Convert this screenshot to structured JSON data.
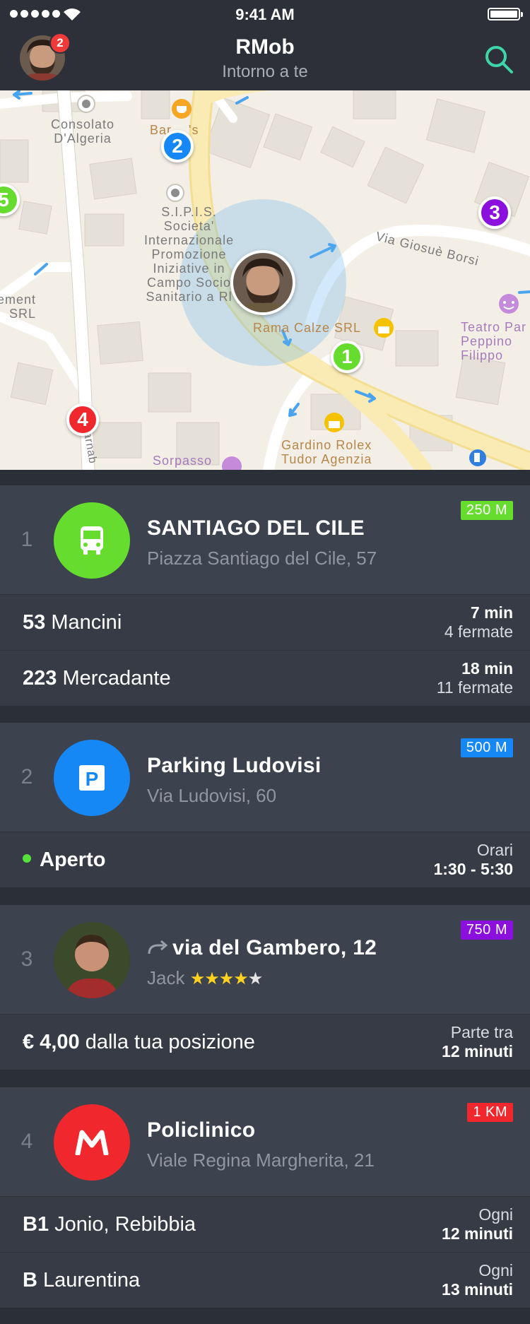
{
  "status_bar": {
    "time": "9:41 AM"
  },
  "header": {
    "title": "RMob",
    "subtitle": "Intorno a te",
    "notification_count": "2"
  },
  "map": {
    "labels": {
      "consolato": "Consolato\nD'Algeria",
      "bar": "Bar ...'s",
      "sipis": "S.I.P.I.S.\nSocieta'\nInternazionale\nPromozione\nIniziative in\nCampo Socio\nSanitario a Rl",
      "via_borsi": "Via Giosuè Borsi",
      "ement": "ement\nSRL",
      "rama": "Rama Calze SRL",
      "teatro": "Teatro Par\nPeppino\nFilippo",
      "gardino": "Gardino Rolex\nTudor Agenzia",
      "sorpasso": "Sorpasso",
      "street": "arnab"
    },
    "pins": [
      {
        "number": "1",
        "color": "#65dc2e"
      },
      {
        "number": "2",
        "color": "#1588f5"
      },
      {
        "number": "3",
        "color": "#8b10de"
      },
      {
        "number": "4",
        "color": "#f0282d"
      },
      {
        "number": "5",
        "color": "#65dc2e"
      }
    ]
  },
  "cards": [
    {
      "rank": "1",
      "title": "SANTIAGO DEL CILE",
      "subtitle": "Piazza Santiago del Cile, 57",
      "distance": "250 M",
      "distance_color": "#65dc2e",
      "icon": "bus-icon",
      "rows": [
        {
          "number": "53",
          "name": "Mancini",
          "right_top": "7 min",
          "right_bottom": "4 fermate"
        },
        {
          "number": "223",
          "name": "Mercadante",
          "right_top": "18 min",
          "right_bottom": "11 fermate"
        }
      ]
    },
    {
      "rank": "2",
      "title": "Parking Ludovisi",
      "subtitle": "Via Ludovisi, 60",
      "distance": "500 M",
      "distance_color": "#1588f5",
      "icon": "parking-icon",
      "rows": [
        {
          "status": "Aperto",
          "right_top": "Orari",
          "right_bottom": "1:30 - 5:30"
        }
      ]
    },
    {
      "rank": "3",
      "title": "via del Gambero, 12",
      "subtitle": "Jack",
      "distance": "750 M",
      "distance_color": "#8b10de",
      "icon": "driver-avatar",
      "rating": 4,
      "rows": [
        {
          "price": "€ 4,00",
          "text": "dalla tua posizione",
          "right_top": "Parte tra",
          "right_bottom": "12 minuti"
        }
      ]
    },
    {
      "rank": "4",
      "title": "Policlinico",
      "subtitle": "Viale Regina Margherita, 21",
      "distance": "1 KM",
      "distance_color": "#f0282d",
      "icon": "metro-icon",
      "rows": [
        {
          "number": "B1",
          "name": "Jonio, Rebibbia",
          "right_top": "Ogni",
          "right_bottom": "12 minuti"
        },
        {
          "number": "B",
          "name": "Laurentina",
          "right_top": "Ogni",
          "right_bottom": "13 minuti"
        }
      ]
    }
  ]
}
